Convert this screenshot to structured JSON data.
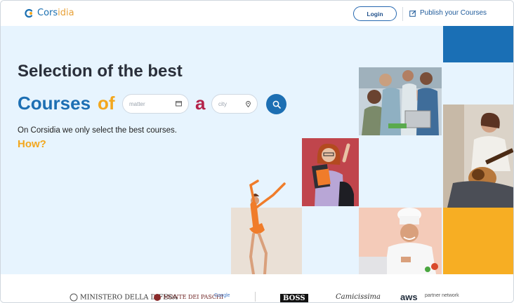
{
  "header": {
    "logo_text_a": "Cors",
    "logo_text_b": "idia",
    "login_label": "Login",
    "publish_label": "Publish your Courses"
  },
  "hero": {
    "headline": "Selection of the best",
    "courses_word": "Courses",
    "of_word": "of",
    "a_word": "a",
    "matter_placeholder": "matter",
    "city_placeholder": "city",
    "tagline": "On Corsidia we only select the best courses.",
    "how_link": "How?"
  },
  "partners": [
    "MINISTERO DELLA DIFESA",
    "MONTE DEI PASCHI",
    "Google",
    "BOSS",
    "Camicissima",
    "aws",
    "partner network"
  ],
  "colors": {
    "brand_blue": "#1d6fb3",
    "brand_yellow": "#f3a71d",
    "brand_red": "#b4234a",
    "hero_bg": "#e7f4fe"
  }
}
